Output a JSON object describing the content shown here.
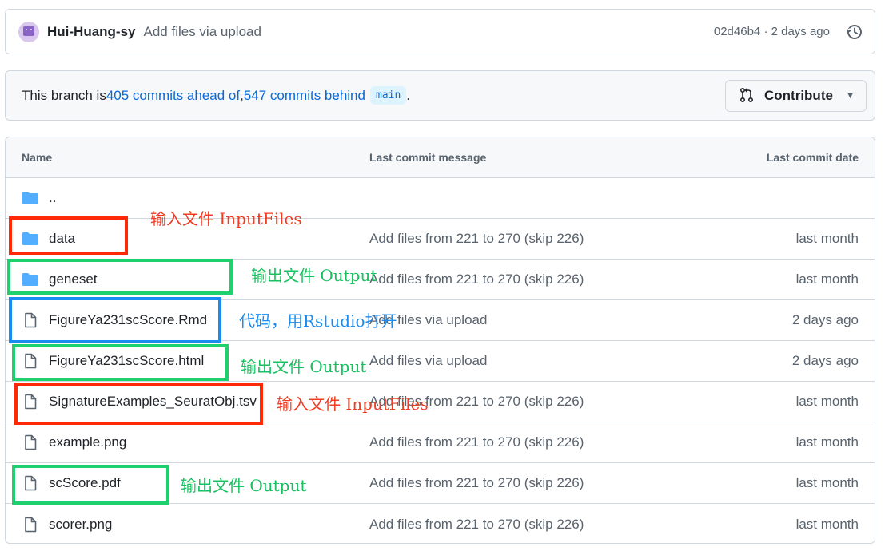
{
  "commit": {
    "author": "Hui-Huang-sy",
    "message": "Add files via upload",
    "meta": "02d46b4 · 2 days ago"
  },
  "branch": {
    "prefix": "This branch is ",
    "ahead": "405 commits ahead of",
    "separator": ", ",
    "behind": "547 commits behind",
    "base": "main",
    "suffix": ".",
    "contribute_label": "Contribute"
  },
  "table": {
    "headers": {
      "name": "Name",
      "message": "Last commit message",
      "date": "Last commit date"
    },
    "rows": [
      {
        "type": "folder",
        "name": "..",
        "message": "",
        "date": ""
      },
      {
        "type": "folder",
        "name": "data",
        "message": "Add files from 221 to 270 (skip 226)",
        "date": "last month"
      },
      {
        "type": "folder",
        "name": "geneset",
        "message": "Add files from 221 to 270 (skip 226)",
        "date": "last month"
      },
      {
        "type": "file",
        "name": "FigureYa231scScore.Rmd",
        "message": "Add files via upload",
        "date": "2 days ago"
      },
      {
        "type": "file",
        "name": "FigureYa231scScore.html",
        "message": "Add files via upload",
        "date": "2 days ago"
      },
      {
        "type": "file",
        "name": "SignatureExamples_SeuratObj.tsv",
        "message": "Add files from 221 to 270 (skip 226)",
        "date": "last month"
      },
      {
        "type": "file",
        "name": "example.png",
        "message": "Add files from 221 to 270 (skip 226)",
        "date": "last month"
      },
      {
        "type": "file",
        "name": "scScore.pdf",
        "message": "Add files from 221 to 270 (skip 226)",
        "date": "last month"
      },
      {
        "type": "file",
        "name": "scorer.png",
        "message": "Add files from 221 to 270 (skip 226)",
        "date": "last month"
      }
    ]
  },
  "annotations": {
    "input_data": "输入文件 InputFiles",
    "output_geneset": "输出文件 Output",
    "code_rmd": "代码，用Rstudio打开",
    "output_html": "输出文件 Output",
    "input_tsv": "输入文件 InputFiles",
    "output_pdf": "输出文件 Output"
  },
  "colors": {
    "link": "#0969da",
    "folder_icon": "#54aeff",
    "annotation_input": "#ff2a05",
    "annotation_output": "#1fd06f",
    "annotation_code": "#1a8cf0"
  }
}
